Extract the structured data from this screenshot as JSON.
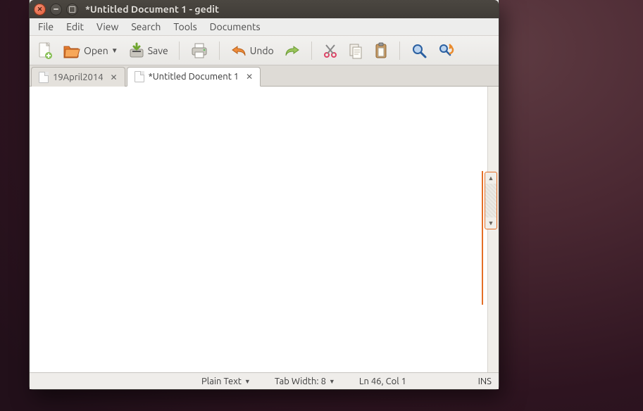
{
  "window": {
    "title": "*Untitled Document 1 - gedit"
  },
  "menubar": {
    "items": [
      "File",
      "Edit",
      "View",
      "Search",
      "Tools",
      "Documents"
    ]
  },
  "toolbar": {
    "open_label": "Open",
    "save_label": "Save",
    "undo_label": "Undo"
  },
  "tabs": [
    {
      "label": "19April2014",
      "active": false
    },
    {
      "label": "*Untitled Document 1",
      "active": true
    }
  ],
  "statusbar": {
    "syntax": "Plain Text",
    "tab_width": "Tab Width: 8",
    "position": "Ln 46, Col 1",
    "insert_mode": "INS"
  }
}
